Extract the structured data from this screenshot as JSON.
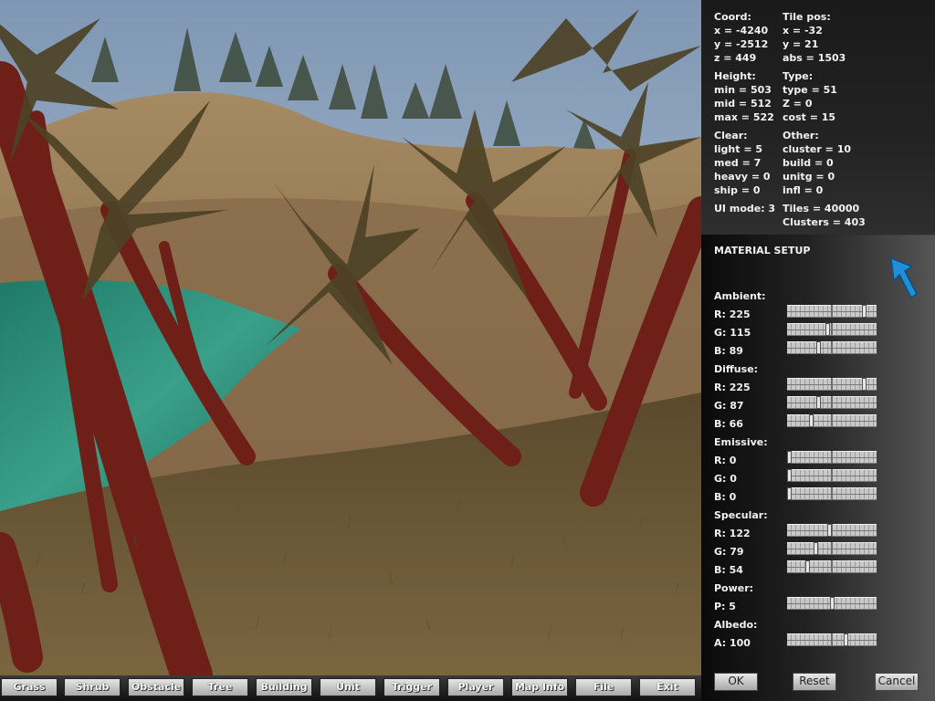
{
  "info": {
    "coord": {
      "title": "Coord:",
      "x": "x = -4240",
      "y": "y = -2512",
      "z": "z = 449"
    },
    "tile_pos": {
      "title": "Tile pos:",
      "x": "x = -32",
      "y": "y = 21",
      "abs": "abs = 1503"
    },
    "height": {
      "title": "Height:",
      "min": "min = 503",
      "mid": "mid = 512",
      "max": "max = 522"
    },
    "type": {
      "title": "Type:",
      "type": "type = 51",
      "z": "Z = 0",
      "cost": "cost = 15"
    },
    "clear": {
      "title": "Clear:",
      "light": "light = 5",
      "med": "med = 7",
      "heavy": "heavy = 0",
      "ship": "ship = 0"
    },
    "other": {
      "title": "Other:",
      "cluster": "cluster = 10",
      "build": "build = 0",
      "unitg": "unitg = 0",
      "infl": "infl = 0"
    },
    "ui_mode": "UI mode: 3",
    "tiles": "Tiles = 40000",
    "clusters": "Clusters = 403"
  },
  "material": {
    "title": "MATERIAL SETUP",
    "ambient": {
      "title": "Ambient:",
      "r_label": "R: 225",
      "g_label": "G: 115",
      "b_label": "B: 89",
      "r": 225,
      "g": 115,
      "b": 89
    },
    "diffuse": {
      "title": "Diffuse:",
      "r_label": "R: 225",
      "g_label": "G: 87",
      "b_label": "B: 66",
      "r": 225,
      "g": 87,
      "b": 66
    },
    "emissive": {
      "title": "Emissive:",
      "r_label": "R: 0",
      "g_label": "G: 0",
      "b_label": "B: 0",
      "r": 0,
      "g": 0,
      "b": 0
    },
    "specular": {
      "title": "Specular:",
      "r_label": "R: 122",
      "g_label": "G: 79",
      "b_label": "B: 54",
      "r": 122,
      "g": 79,
      "b": 54
    },
    "power": {
      "title": "Power:",
      "p_label": "P: 5",
      "p_fraction": 0.5
    },
    "albedo": {
      "title": "Albedo:",
      "a_label": "A: 100",
      "a_fraction": 0.67
    },
    "buttons": {
      "ok": "OK",
      "reset": "Reset",
      "cancel": "Cancel"
    }
  },
  "toolbar": {
    "grass": "Grass",
    "shrub": "Shrub",
    "obstacle": "Obstacle",
    "tree": "Tree",
    "building": "Building",
    "unit": "Unit",
    "trigger": "Trigger",
    "player": "Player",
    "map_info": "Map Info",
    "file": "File",
    "exit": "Exit"
  },
  "cursor_icon": "arrow-cursor-icon",
  "colors": {
    "panel_text": "#f2f2f2",
    "sky": "#a9bcd0",
    "water": "#2f8c78",
    "sand": "#8e7350",
    "palm_trunk": "#6e2018",
    "cursor": "#1f8fd8"
  }
}
